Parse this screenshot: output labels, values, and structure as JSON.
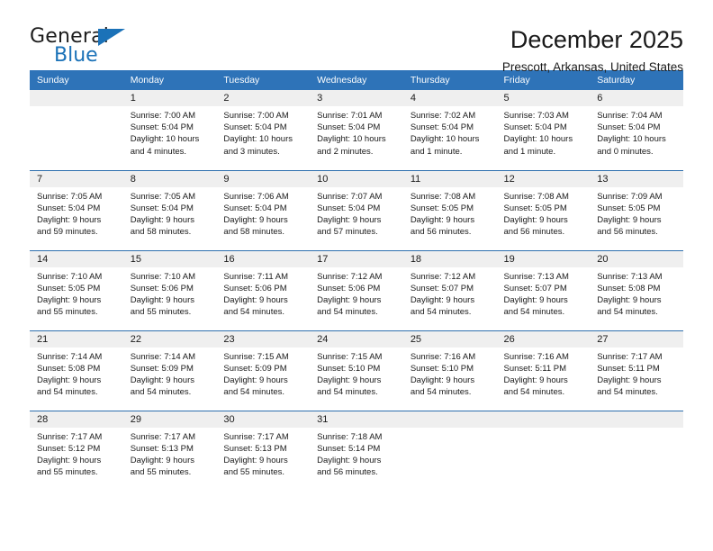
{
  "brand": {
    "name_top": "General",
    "name_bottom": "Blue",
    "accent_color": "#1b72b8"
  },
  "header": {
    "title": "December 2025",
    "subtitle": "Prescott, Arkansas, United States"
  },
  "theme": {
    "header_blue": "#2e73b8",
    "row_divider_blue": "#2e6fae",
    "daynum_band": "#efefef"
  },
  "weekday_headers": [
    "Sunday",
    "Monday",
    "Tuesday",
    "Wednesday",
    "Thursday",
    "Friday",
    "Saturday"
  ],
  "weeks": [
    [
      {
        "day": "",
        "sunrise": "",
        "sunset": "",
        "daylight": ""
      },
      {
        "day": "1",
        "sunrise": "Sunrise: 7:00 AM",
        "sunset": "Sunset: 5:04 PM",
        "daylight": "Daylight: 10 hours and 4 minutes."
      },
      {
        "day": "2",
        "sunrise": "Sunrise: 7:00 AM",
        "sunset": "Sunset: 5:04 PM",
        "daylight": "Daylight: 10 hours and 3 minutes."
      },
      {
        "day": "3",
        "sunrise": "Sunrise: 7:01 AM",
        "sunset": "Sunset: 5:04 PM",
        "daylight": "Daylight: 10 hours and 2 minutes."
      },
      {
        "day": "4",
        "sunrise": "Sunrise: 7:02 AM",
        "sunset": "Sunset: 5:04 PM",
        "daylight": "Daylight: 10 hours and 1 minute."
      },
      {
        "day": "5",
        "sunrise": "Sunrise: 7:03 AM",
        "sunset": "Sunset: 5:04 PM",
        "daylight": "Daylight: 10 hours and 1 minute."
      },
      {
        "day": "6",
        "sunrise": "Sunrise: 7:04 AM",
        "sunset": "Sunset: 5:04 PM",
        "daylight": "Daylight: 10 hours and 0 minutes."
      }
    ],
    [
      {
        "day": "7",
        "sunrise": "Sunrise: 7:05 AM",
        "sunset": "Sunset: 5:04 PM",
        "daylight": "Daylight: 9 hours and 59 minutes."
      },
      {
        "day": "8",
        "sunrise": "Sunrise: 7:05 AM",
        "sunset": "Sunset: 5:04 PM",
        "daylight": "Daylight: 9 hours and 58 minutes."
      },
      {
        "day": "9",
        "sunrise": "Sunrise: 7:06 AM",
        "sunset": "Sunset: 5:04 PM",
        "daylight": "Daylight: 9 hours and 58 minutes."
      },
      {
        "day": "10",
        "sunrise": "Sunrise: 7:07 AM",
        "sunset": "Sunset: 5:04 PM",
        "daylight": "Daylight: 9 hours and 57 minutes."
      },
      {
        "day": "11",
        "sunrise": "Sunrise: 7:08 AM",
        "sunset": "Sunset: 5:05 PM",
        "daylight": "Daylight: 9 hours and 56 minutes."
      },
      {
        "day": "12",
        "sunrise": "Sunrise: 7:08 AM",
        "sunset": "Sunset: 5:05 PM",
        "daylight": "Daylight: 9 hours and 56 minutes."
      },
      {
        "day": "13",
        "sunrise": "Sunrise: 7:09 AM",
        "sunset": "Sunset: 5:05 PM",
        "daylight": "Daylight: 9 hours and 56 minutes."
      }
    ],
    [
      {
        "day": "14",
        "sunrise": "Sunrise: 7:10 AM",
        "sunset": "Sunset: 5:05 PM",
        "daylight": "Daylight: 9 hours and 55 minutes."
      },
      {
        "day": "15",
        "sunrise": "Sunrise: 7:10 AM",
        "sunset": "Sunset: 5:06 PM",
        "daylight": "Daylight: 9 hours and 55 minutes."
      },
      {
        "day": "16",
        "sunrise": "Sunrise: 7:11 AM",
        "sunset": "Sunset: 5:06 PM",
        "daylight": "Daylight: 9 hours and 54 minutes."
      },
      {
        "day": "17",
        "sunrise": "Sunrise: 7:12 AM",
        "sunset": "Sunset: 5:06 PM",
        "daylight": "Daylight: 9 hours and 54 minutes."
      },
      {
        "day": "18",
        "sunrise": "Sunrise: 7:12 AM",
        "sunset": "Sunset: 5:07 PM",
        "daylight": "Daylight: 9 hours and 54 minutes."
      },
      {
        "day": "19",
        "sunrise": "Sunrise: 7:13 AM",
        "sunset": "Sunset: 5:07 PM",
        "daylight": "Daylight: 9 hours and 54 minutes."
      },
      {
        "day": "20",
        "sunrise": "Sunrise: 7:13 AM",
        "sunset": "Sunset: 5:08 PM",
        "daylight": "Daylight: 9 hours and 54 minutes."
      }
    ],
    [
      {
        "day": "21",
        "sunrise": "Sunrise: 7:14 AM",
        "sunset": "Sunset: 5:08 PM",
        "daylight": "Daylight: 9 hours and 54 minutes."
      },
      {
        "day": "22",
        "sunrise": "Sunrise: 7:14 AM",
        "sunset": "Sunset: 5:09 PM",
        "daylight": "Daylight: 9 hours and 54 minutes."
      },
      {
        "day": "23",
        "sunrise": "Sunrise: 7:15 AM",
        "sunset": "Sunset: 5:09 PM",
        "daylight": "Daylight: 9 hours and 54 minutes."
      },
      {
        "day": "24",
        "sunrise": "Sunrise: 7:15 AM",
        "sunset": "Sunset: 5:10 PM",
        "daylight": "Daylight: 9 hours and 54 minutes."
      },
      {
        "day": "25",
        "sunrise": "Sunrise: 7:16 AM",
        "sunset": "Sunset: 5:10 PM",
        "daylight": "Daylight: 9 hours and 54 minutes."
      },
      {
        "day": "26",
        "sunrise": "Sunrise: 7:16 AM",
        "sunset": "Sunset: 5:11 PM",
        "daylight": "Daylight: 9 hours and 54 minutes."
      },
      {
        "day": "27",
        "sunrise": "Sunrise: 7:17 AM",
        "sunset": "Sunset: 5:11 PM",
        "daylight": "Daylight: 9 hours and 54 minutes."
      }
    ],
    [
      {
        "day": "28",
        "sunrise": "Sunrise: 7:17 AM",
        "sunset": "Sunset: 5:12 PM",
        "daylight": "Daylight: 9 hours and 55 minutes."
      },
      {
        "day": "29",
        "sunrise": "Sunrise: 7:17 AM",
        "sunset": "Sunset: 5:13 PM",
        "daylight": "Daylight: 9 hours and 55 minutes."
      },
      {
        "day": "30",
        "sunrise": "Sunrise: 7:17 AM",
        "sunset": "Sunset: 5:13 PM",
        "daylight": "Daylight: 9 hours and 55 minutes."
      },
      {
        "day": "31",
        "sunrise": "Sunrise: 7:18 AM",
        "sunset": "Sunset: 5:14 PM",
        "daylight": "Daylight: 9 hours and 56 minutes."
      },
      {
        "day": "",
        "sunrise": "",
        "sunset": "",
        "daylight": ""
      },
      {
        "day": "",
        "sunrise": "",
        "sunset": "",
        "daylight": ""
      },
      {
        "day": "",
        "sunrise": "",
        "sunset": "",
        "daylight": ""
      }
    ]
  ]
}
